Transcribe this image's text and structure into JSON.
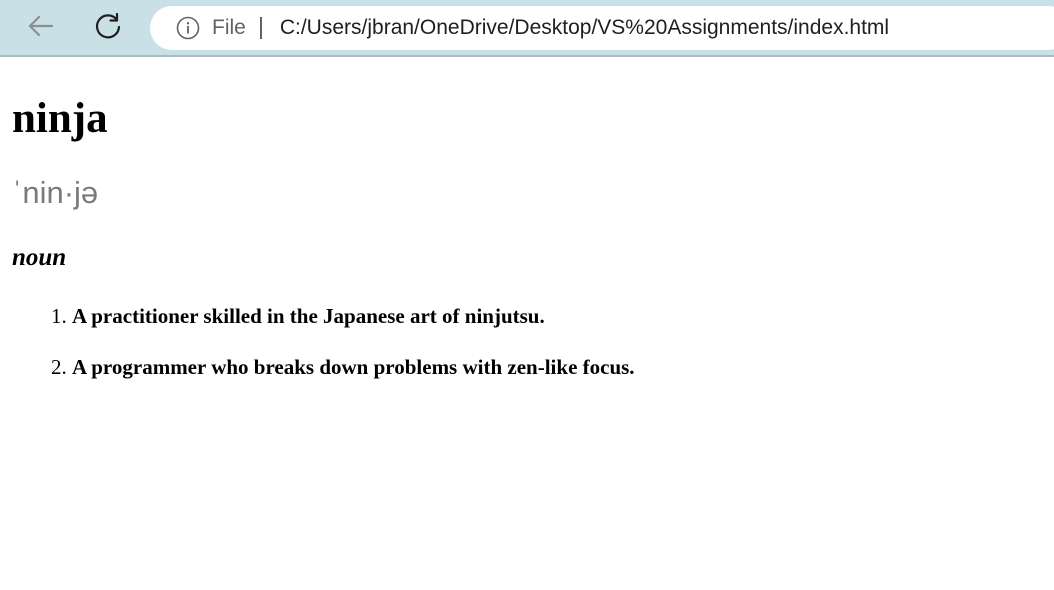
{
  "browser": {
    "back_icon": "arrow-left-icon",
    "reload_icon": "reload-icon",
    "info_icon": "info-icon",
    "scheme_label": "File",
    "url": "C:/Users/jbran/OneDrive/Desktop/VS%20Assignments/index.html"
  },
  "page": {
    "word": "ninja",
    "pronunciation": "ˈnin·jə",
    "part_of_speech": "noun",
    "definitions": [
      "A practitioner skilled in the Japanese art of ninjutsu.",
      "A programmer who breaks down problems with zen-like focus."
    ]
  }
}
